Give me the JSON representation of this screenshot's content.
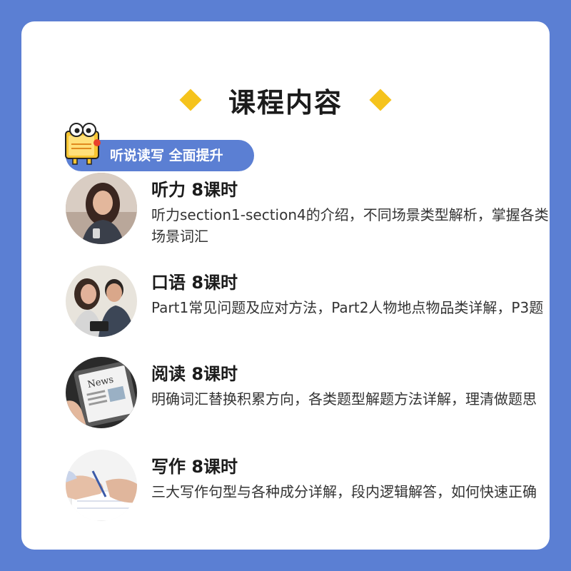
{
  "header": {
    "title": "课程内容"
  },
  "tag": {
    "label": "听说读写 全面提升"
  },
  "items": [
    {
      "title": "听力 8课时",
      "desc": "听力section1-section4的介绍，不同场景类型解析，掌握各类场景词汇",
      "icon": "woman-phone-photo"
    },
    {
      "title": "口语 8课时",
      "desc": "Part1常见问题及应对方法，Part2人物地点物品类详解，P3题",
      "icon": "couple-tablet-photo"
    },
    {
      "title": "阅读 8课时",
      "desc": "明确词汇替换积累方向，各类题型解题方法详解，理清做题思",
      "icon": "news-tablet-photo"
    },
    {
      "title": "写作 8课时",
      "desc": "三大写作句型与各种成分详解，段内逻辑解答，如何快速正确",
      "icon": "hand-writing-photo"
    }
  ],
  "colors": {
    "background": "#5b7fd3",
    "accent": "#f5c31c",
    "card": "#ffffff"
  }
}
